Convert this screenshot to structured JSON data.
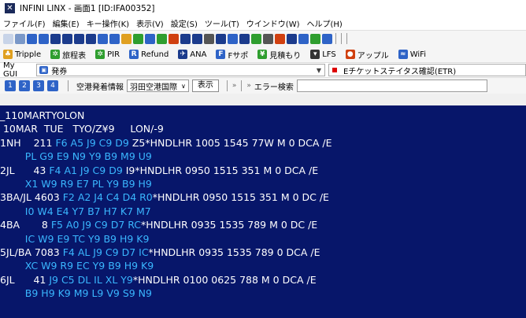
{
  "title": "INFINI LINX - 画面1 [ID:IFA00352]",
  "menu": [
    "ファイル(F)",
    "編集(E)",
    "キー操作(K)",
    "表示(V)",
    "設定(S)",
    "ツール(T)",
    "ウインドウ(W)",
    "ヘルプ(H)"
  ],
  "toolbar2": [
    {
      "icon": "tripple-icon",
      "label": "Tripple",
      "color": "#e0a020"
    },
    {
      "icon": "fare-table-icon",
      "label": "旅程表",
      "color": "#2f9e2f"
    },
    {
      "icon": "pir-icon",
      "label": "PIR",
      "color": "#2f9e2f"
    },
    {
      "icon": "refund-icon",
      "label": "Refund",
      "color": "#2e63c7",
      "glyph": "R"
    },
    {
      "icon": "ana-icon",
      "label": "ANA",
      "color": "#1b3b8c",
      "glyph": "+"
    },
    {
      "icon": "fsupport-icon",
      "label": "Fサポ",
      "color": "#2e63c7",
      "glyph": "F"
    },
    {
      "icon": "estimate-icon",
      "label": "見積もり",
      "color": "#2f9e2f",
      "glyph": "¥"
    },
    {
      "icon": "lfs-icon",
      "label": "LFS",
      "color": "#333333",
      "glyph": "▾"
    },
    {
      "icon": "apple-icon",
      "label": "アップル",
      "color": "#d04010",
      "glyph": "●"
    },
    {
      "icon": "wifi-icon",
      "label": "WiFi",
      "color": "#2e63c7",
      "glyph": "≈"
    }
  ],
  "gui": {
    "label": "My GUI",
    "value": "発券",
    "status": "Eチケットステイタス確認(ETR)"
  },
  "toolbar3": {
    "nums": [
      "1",
      "2",
      "3",
      "4"
    ],
    "category": "空港発着情報",
    "airport": "羽田空港国際",
    "display_button": "表示",
    "error_search": "エラー検索"
  },
  "terminal": [
    [
      {
        "t": "_110MARTYOLON"
      }
    ],
    [
      {
        "t": " 10MAR  TUE   TYO/Z¥9     LON/-9"
      }
    ],
    [
      {
        "t": "1NH    211 "
      },
      {
        "t": "F6 A5 J9 C9 D9 ",
        "c": 1
      },
      {
        "t": "Z5*HNDLHR 1005 1545 77W M 0 DCA /E"
      }
    ],
    [
      {
        "t": "        PL G9 E9 N9 Y9 B9 M9 U9",
        "c": 1
      }
    ],
    [
      {
        "t": "2JL      43 "
      },
      {
        "t": "F4 A1 J9 C9 D9 ",
        "c": 1
      },
      {
        "t": "I9*HNDLHR 0950 1515 351 M 0 DCA /E"
      }
    ],
    [
      {
        "t": "        X1 W9 R9 E7 PL Y9 B9 H9",
        "c": 1
      }
    ],
    [
      {
        "t": "3BA/JL 4603 "
      },
      {
        "t": "F2 A2 J4 C4 D4 R0",
        "c": 1
      },
      {
        "t": "*HNDLHR 0950 1515 351 M 0 DC /E"
      }
    ],
    [
      {
        "t": "        I0 W4 E4 Y7 B7 H7 K7 M7",
        "c": 1
      }
    ],
    [
      {
        "t": "4BA       8 "
      },
      {
        "t": "F5 A0 J9 C9 D7 RC",
        "c": 1
      },
      {
        "t": "*HNDLHR 0935 1535 789 M 0 DC /E"
      }
    ],
    [
      {
        "t": "        IC W9 E9 TC Y9 B9 H9 K9",
        "c": 1
      }
    ],
    [
      {
        "t": "5JL/BA 7083 "
      },
      {
        "t": "F4 AL J9 C9 D7 IC",
        "c": 1
      },
      {
        "t": "*HNDLHR 0935 1535 789 0 DCA /E"
      }
    ],
    [
      {
        "t": "        XC W9 R9 EC Y9 B9 H9 K9",
        "c": 1
      }
    ],
    [
      {
        "t": "6JL      41 "
      },
      {
        "t": "J9 C5 DL IL XL Y9",
        "c": 1
      },
      {
        "t": "*HNDLHR 0100 0625 788 M 0 DCA /E"
      }
    ],
    [
      {
        "t": "        B9 H9 K9 M9 L9 V9 S9 N9",
        "c": 1
      }
    ]
  ]
}
